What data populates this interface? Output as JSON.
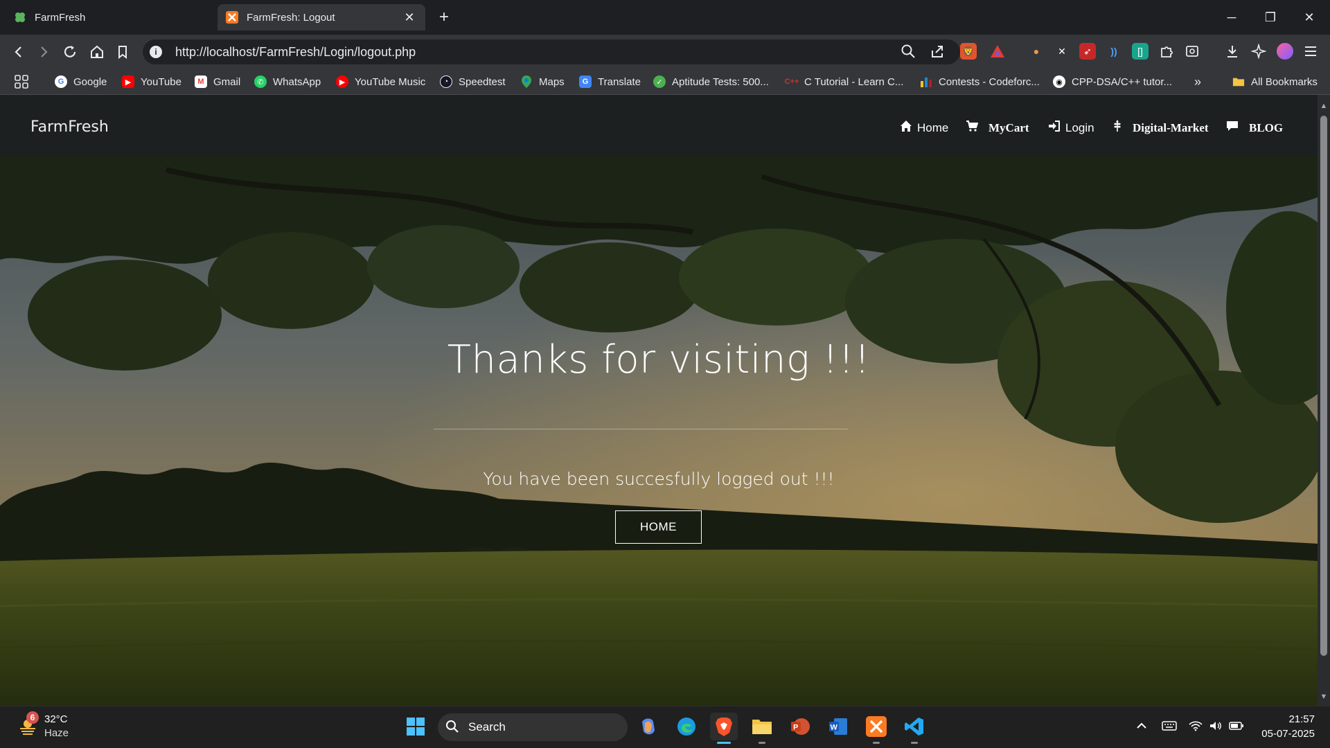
{
  "browser": {
    "tabs": [
      {
        "title": "FarmFresh",
        "active": false
      },
      {
        "title": "FarmFresh: Logout",
        "active": true
      }
    ],
    "new_tab": "+",
    "url": "http://localhost/FarmFresh/Login/logout.php",
    "bookmarks": [
      {
        "label": "Google",
        "color": "#ffffff"
      },
      {
        "label": "YouTube",
        "color": "#ff0000"
      },
      {
        "label": "Gmail",
        "color": "#ea4335"
      },
      {
        "label": "WhatsApp",
        "color": "#25d366"
      },
      {
        "label": "YouTube Music",
        "color": "#ff0000"
      },
      {
        "label": "Speedtest",
        "color": "#141526"
      },
      {
        "label": "Maps",
        "color": "#34a853"
      },
      {
        "label": "Translate",
        "color": "#4285f4"
      },
      {
        "label": "Aptitude Tests: 500...",
        "color": "#4caf50"
      },
      {
        "label": "C Tutorial - Learn C...",
        "color": "#c0392b"
      },
      {
        "label": "Contests - Codeforc...",
        "color": "#1f8acb"
      },
      {
        "label": "CPP-DSA/C++ tutor...",
        "color": "#ffffff"
      }
    ],
    "all_bookmarks": "All Bookmarks"
  },
  "site": {
    "brand": "FarmFresh",
    "nav": [
      {
        "label": "Home",
        "icon": "home-icon"
      },
      {
        "label": "MyCart",
        "icon": "cart-icon"
      },
      {
        "label": "Login",
        "icon": "login-icon"
      },
      {
        "label": "Digital-Market",
        "icon": "grain-icon"
      },
      {
        "label": "BLOG",
        "icon": "comment-icon"
      }
    ]
  },
  "hero": {
    "title": "Thanks for visiting !!!",
    "subtitle": "You have been succesfully logged out !!!",
    "button": "HOME"
  },
  "taskbar": {
    "weather": {
      "temp": "32°C",
      "desc": "Haze",
      "badge": "6"
    },
    "search_label": "Search",
    "time": "21:57",
    "date": "05-07-2025"
  },
  "colors": {
    "nav_bg": "#1d2020",
    "accent_red": "#d9534f"
  }
}
